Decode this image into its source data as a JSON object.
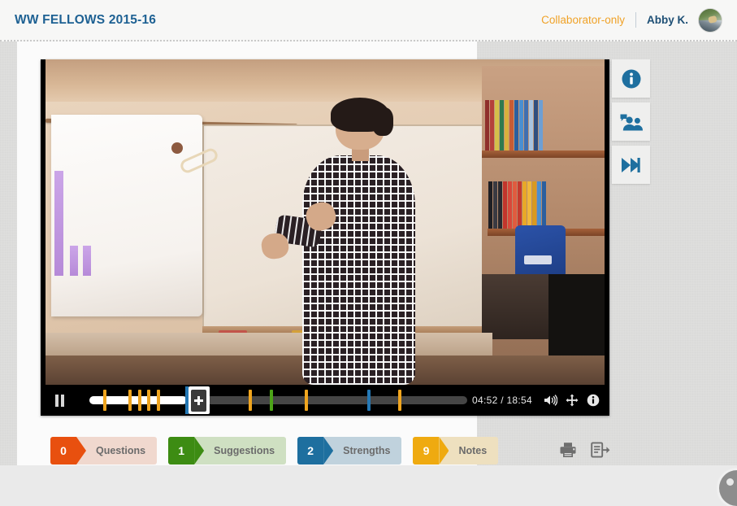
{
  "header": {
    "title": "WW FELLOWS 2015-16",
    "collaborator_label": "Collaborator-only",
    "user_name": "Abby K.",
    "avatar_name": "user-avatar",
    "title_color": "#1e6193",
    "collaborator_color": "#f0a227",
    "user_color": "#1e4f75"
  },
  "video": {
    "scene_description": "Classroom with teacher presenting in front of whiteboard, projection screen with purple bar chart at left, bookshelves at right",
    "controls": {
      "play_pause_icon": "pause-icon",
      "play_pause_state": "playing",
      "current_time": "04:52",
      "total_time": "18:54",
      "time_display": "04:52 / 18:54",
      "progress_percent": 25.8,
      "volume_icon": "volume-icon",
      "fullscreen_icon": "move-resize-icon",
      "info_icon": "info-circle-icon",
      "add_marker_icon": "plus-icon",
      "add_marker_label": "Add marker"
    },
    "timeline_markers": [
      {
        "pos": 3.7,
        "color": "#f0a51e",
        "type": "note"
      },
      {
        "pos": 10.3,
        "color": "#f0a51e",
        "type": "note"
      },
      {
        "pos": 12.9,
        "color": "#f0a51e",
        "type": "note"
      },
      {
        "pos": 15.3,
        "color": "#f0a51e",
        "type": "note"
      },
      {
        "pos": 17.8,
        "color": "#f0a51e",
        "type": "note"
      },
      {
        "pos": 26.0,
        "color": "#f0a51e",
        "type": "note"
      },
      {
        "pos": 42.2,
        "color": "#f0a51e",
        "type": "note"
      },
      {
        "pos": 47.7,
        "color": "#4ca318",
        "type": "suggestion"
      },
      {
        "pos": 57.0,
        "color": "#f0a51e",
        "type": "note"
      },
      {
        "pos": 73.5,
        "color": "#2478b5",
        "type": "strength"
      },
      {
        "pos": 81.7,
        "color": "#f0a51e",
        "type": "note"
      }
    ]
  },
  "sidebar": {
    "items": [
      {
        "name": "info-panel-button",
        "icon": "info-circle-icon",
        "label": "Info"
      },
      {
        "name": "collaborators-button",
        "icon": "people-speech-icon",
        "label": "Collaborators"
      },
      {
        "name": "skip-forward-button",
        "icon": "fast-forward-icon",
        "label": "Next"
      }
    ]
  },
  "tabs": [
    {
      "count": "0",
      "label": "Questions",
      "accent": "#e8500f",
      "bg": "#f0d8ce"
    },
    {
      "count": "1",
      "label": "Suggestions",
      "accent": "#3d8c13",
      "bg": "#cfe0c2"
    },
    {
      "count": "2",
      "label": "Strengths",
      "accent": "#1e6f9f",
      "bg": "#c0d2dd"
    },
    {
      "count": "9",
      "label": "Notes",
      "accent": "#efaa10",
      "bg": "#eee0bf"
    }
  ],
  "doc_actions": [
    {
      "name": "print-button",
      "icon": "printer-icon",
      "label": "Print"
    },
    {
      "name": "export-button",
      "icon": "export-doc-icon",
      "label": "Export"
    }
  ],
  "help": {
    "name": "help-bubble",
    "label": "Help"
  }
}
